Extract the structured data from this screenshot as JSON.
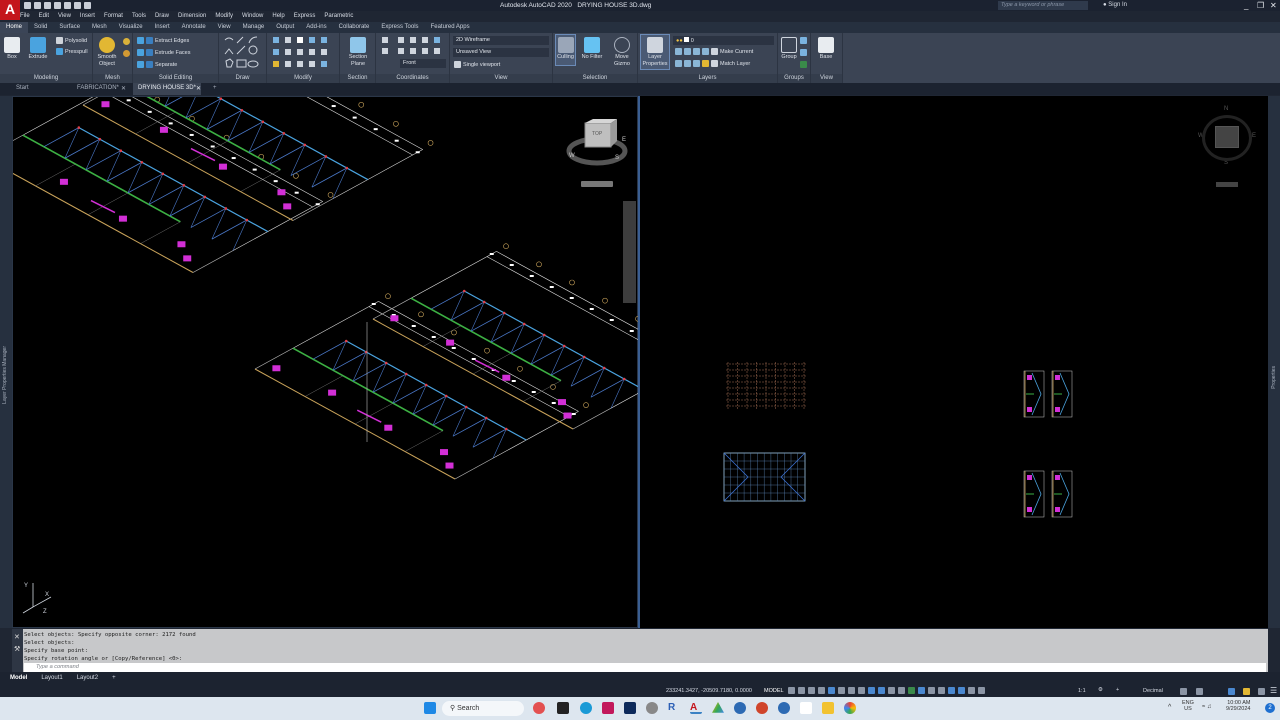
{
  "title": {
    "app": "Autodesk AutoCAD 2020",
    "file": "DRYING HOUSE 3D.dwg",
    "search_placeholder": "Type a keyword or phrase",
    "sign_in": "Sign In"
  },
  "menu": [
    "File",
    "Edit",
    "View",
    "Insert",
    "Format",
    "Tools",
    "Draw",
    "Dimension",
    "Modify",
    "Window",
    "Help",
    "Express",
    "Parametric"
  ],
  "ribbon_tabs": [
    "Home",
    "Solid",
    "Surface",
    "Mesh",
    "Visualize",
    "Insert",
    "Annotate",
    "View",
    "Manage",
    "Output",
    "Add-ins",
    "Collaborate",
    "Express Tools",
    "Featured Apps"
  ],
  "ribbon": {
    "modeling": {
      "title": "Modeling",
      "box": "Box",
      "extrude": "Extrude",
      "polysolid": "Polysolid",
      "presspull": "Presspull"
    },
    "mesh": {
      "title": "Mesh",
      "smooth": "Smooth Object"
    },
    "solid_editing": {
      "title": "Solid Editing",
      "extract_edges": "Extract Edges",
      "extrude_faces": "Extrude Faces",
      "separate": "Separate"
    },
    "draw": {
      "title": "Draw"
    },
    "modify": {
      "title": "Modify"
    },
    "section": {
      "title": "Section",
      "plane": "Section Plane"
    },
    "coordinates": {
      "title": "Coordinates",
      "ucs": "Front"
    },
    "view": {
      "title": "View",
      "visual_style": "2D Wireframe",
      "named_view": "Unsaved View",
      "viewport": "Single viewport"
    },
    "selection": {
      "title": "Selection",
      "culling": "Culling",
      "no_filter": "No Filter",
      "move_gizmo": "Move Gizmo"
    },
    "layers": {
      "title": "Layers",
      "layer_properties": "Layer Properties",
      "current_layer": "0",
      "make_current": "Make Current",
      "match_layer": "Match Layer"
    },
    "groups": {
      "title": "Groups",
      "group": "Group"
    },
    "view2": {
      "title": "View",
      "base": "Base"
    }
  },
  "doc_tabs": [
    {
      "label": "Start"
    },
    {
      "label": "FABRICATION*"
    },
    {
      "label": "DRYING HOUSE 3D*"
    }
  ],
  "viewcube": {
    "top": "TOP",
    "n": "N",
    "s": "S",
    "e": "E",
    "w": "W"
  },
  "ucs": {
    "x": "X",
    "y": "Y",
    "z": "Z"
  },
  "palettes": {
    "left": "Layer Properties Manager",
    "right": "Properties"
  },
  "command": {
    "history": [
      "Select objects: Specify opposite corner: 2172 found",
      "Select objects:",
      "Specify base point:",
      "Specify rotation angle or [Copy/Reference] <0>:"
    ],
    "placeholder": "Type a command"
  },
  "layout_tabs": [
    "Model",
    "Layout1",
    "Layout2",
    "+"
  ],
  "status": {
    "coords": "233241.3427, -20509.7180, 0.0000",
    "space": "MODEL",
    "scale": "1:1",
    "units": "Decimal"
  },
  "taskbar": {
    "search": "Search",
    "lang": "ENG",
    "region": "US",
    "time": "10:00 AM",
    "date": "9/29/2024",
    "badge": "2"
  }
}
